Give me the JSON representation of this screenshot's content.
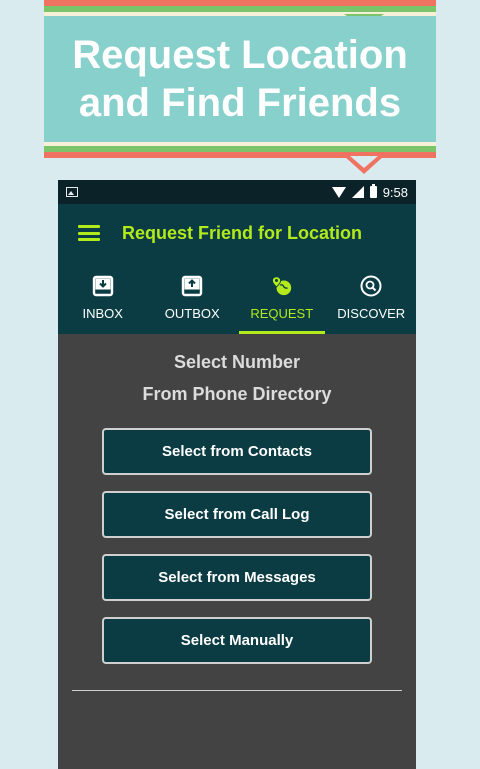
{
  "banner": {
    "line1": "Request Location",
    "line2": "and Find Friends"
  },
  "status_bar": {
    "time": "9:58"
  },
  "app_bar": {
    "title": "Request Friend for Location"
  },
  "tabs": [
    {
      "label": "INBOX",
      "icon": "download-box-icon",
      "active": false
    },
    {
      "label": "OUTBOX",
      "icon": "upload-box-icon",
      "active": false
    },
    {
      "label": "REQUEST",
      "icon": "location-globe-icon",
      "active": true
    },
    {
      "label": "DISCOVER",
      "icon": "search-circle-icon",
      "active": false
    }
  ],
  "main": {
    "heading_line1": "Select Number",
    "heading_line2": "From Phone Directory",
    "buttons": [
      {
        "label": "Select from Contacts"
      },
      {
        "label": "Select from Call Log"
      },
      {
        "label": "Select from Messages"
      },
      {
        "label": "Select Manually"
      }
    ]
  },
  "colors": {
    "accent": "#b2ea1c",
    "app_bar": "#0b3c44",
    "banner": "#88d0cc",
    "background": "#d9ebee"
  }
}
